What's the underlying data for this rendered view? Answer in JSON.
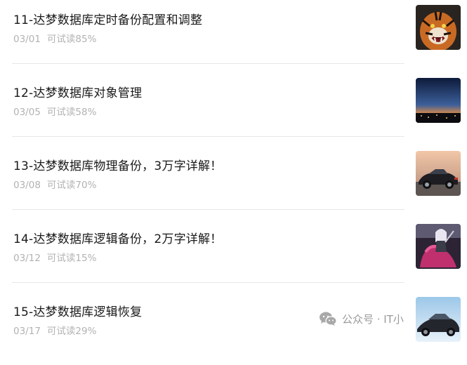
{
  "articles": [
    {
      "title": "11-达梦数据库定时备份配置和调整",
      "date": "03/01",
      "trial": "可试读85%",
      "thumb_icon": "tiger-image"
    },
    {
      "title": "12-达梦数据库对象管理",
      "date": "03/05",
      "trial": "可试读58%",
      "thumb_icon": "night-city-image"
    },
    {
      "title": "13-达梦数据库物理备份，3万字详解！",
      "date": "03/08",
      "trial": "可试读70%",
      "thumb_icon": "sports-car-image"
    },
    {
      "title": "14-达梦数据库逻辑备份，2万字详解！",
      "date": "03/12",
      "trial": "可试读15%",
      "thumb_icon": "fantasy-rider-image"
    },
    {
      "title": "15-达梦数据库逻辑恢复",
      "date": "03/17",
      "trial": "可试读29%",
      "thumb_icon": "supercar-image"
    }
  ],
  "watermark": {
    "text": "公众号 · IT小",
    "icon": "wechat-icon"
  },
  "colors": {
    "title": "#1a1a1a",
    "meta": "#b2b2b2",
    "divider": "#e7e7e7"
  }
}
